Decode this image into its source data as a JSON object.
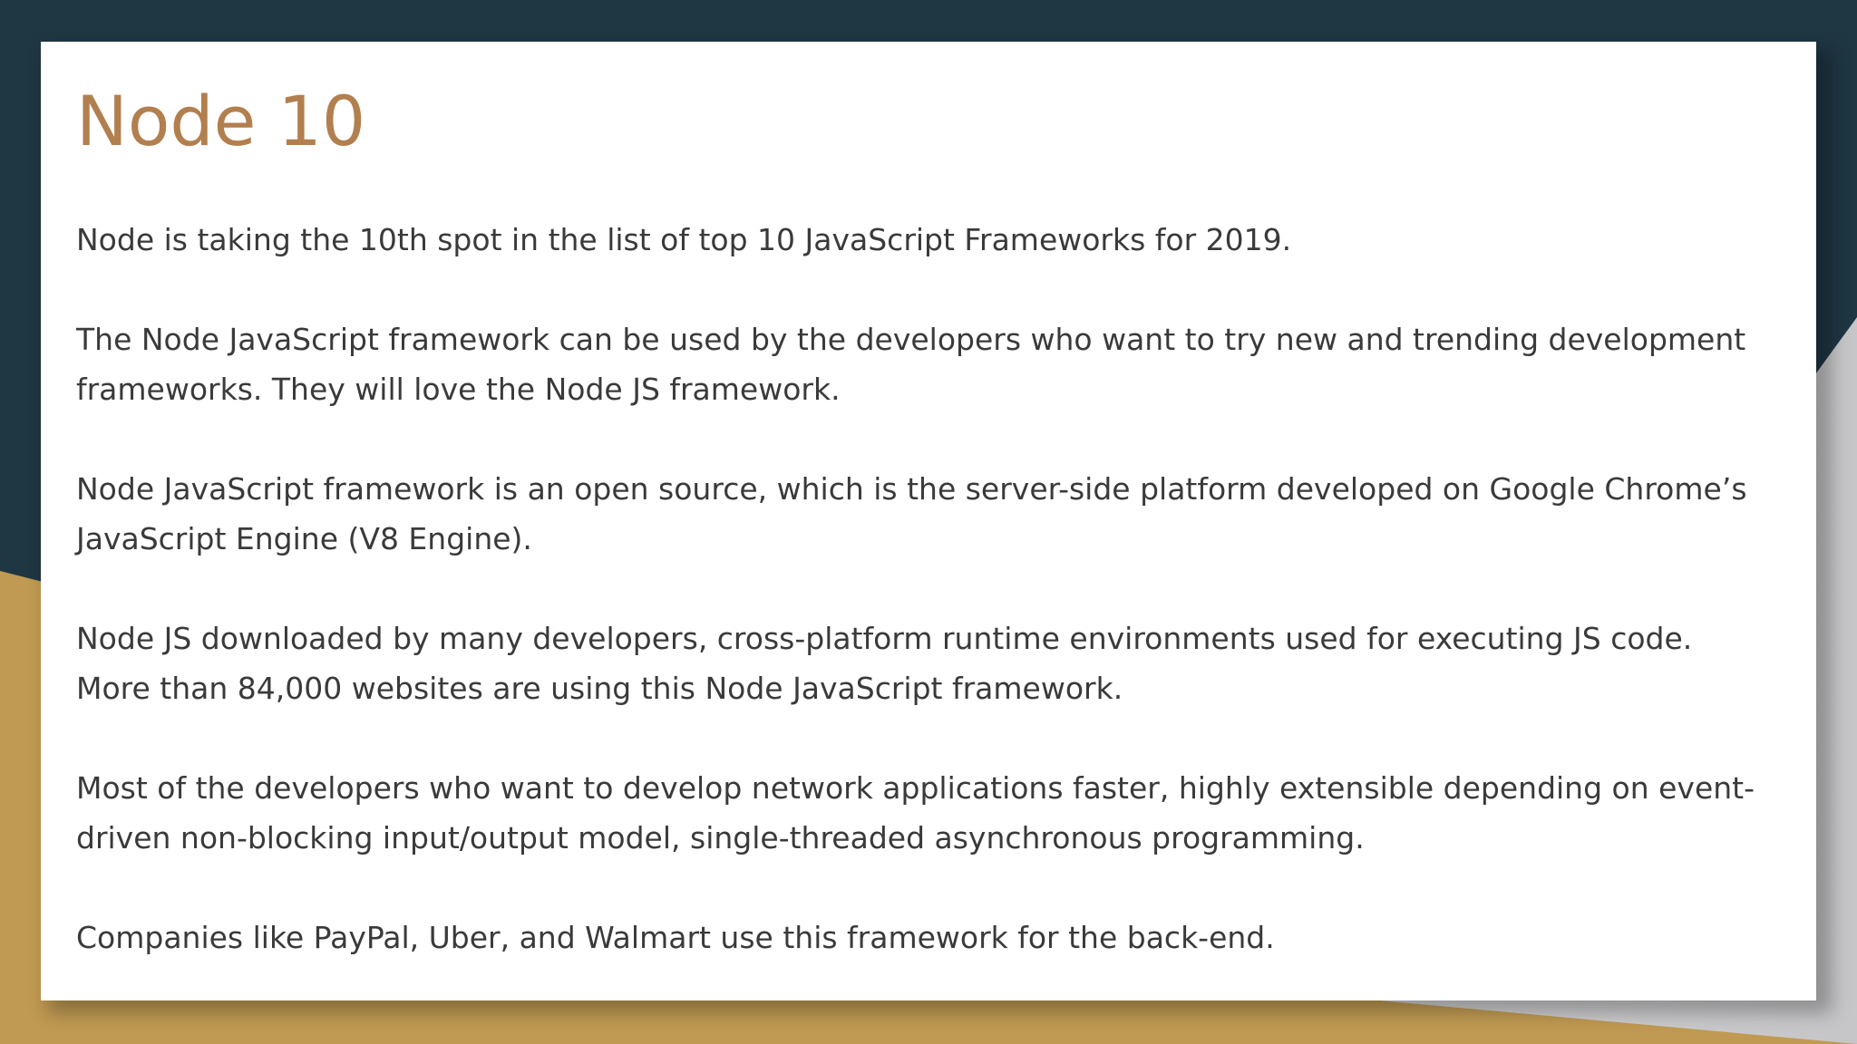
{
  "slide": {
    "title": "Node 10",
    "paragraphs": [
      "Node is taking the 10th spot in the list of top 10 JavaScript Frameworks for 2019.",
      "The Node JavaScript framework can be used by the developers who want to try new and trending development frameworks. They will love the Node JS framework.",
      "Node JavaScript framework is an open source, which is the server-side platform developed on Google Chrome’s JavaScript Engine (V8 Engine).",
      "Node JS downloaded by many developers, cross-platform runtime environments used for executing JS code. More than 84,000 websites are using this Node JavaScript framework.",
      "Most of the developers who want to develop network applications faster, highly extensible depending on event-driven non-blocking input/output model, single-threaded asynchronous programming.",
      "Companies like PayPal, Uber, and Walmart use this framework for the back-end."
    ]
  },
  "colors": {
    "background_navy": "#1f3643",
    "accent_gold": "#c09a52",
    "title_color": "#b27f4f",
    "text_color": "#3a3a3a",
    "slide_background": "#ffffff"
  }
}
